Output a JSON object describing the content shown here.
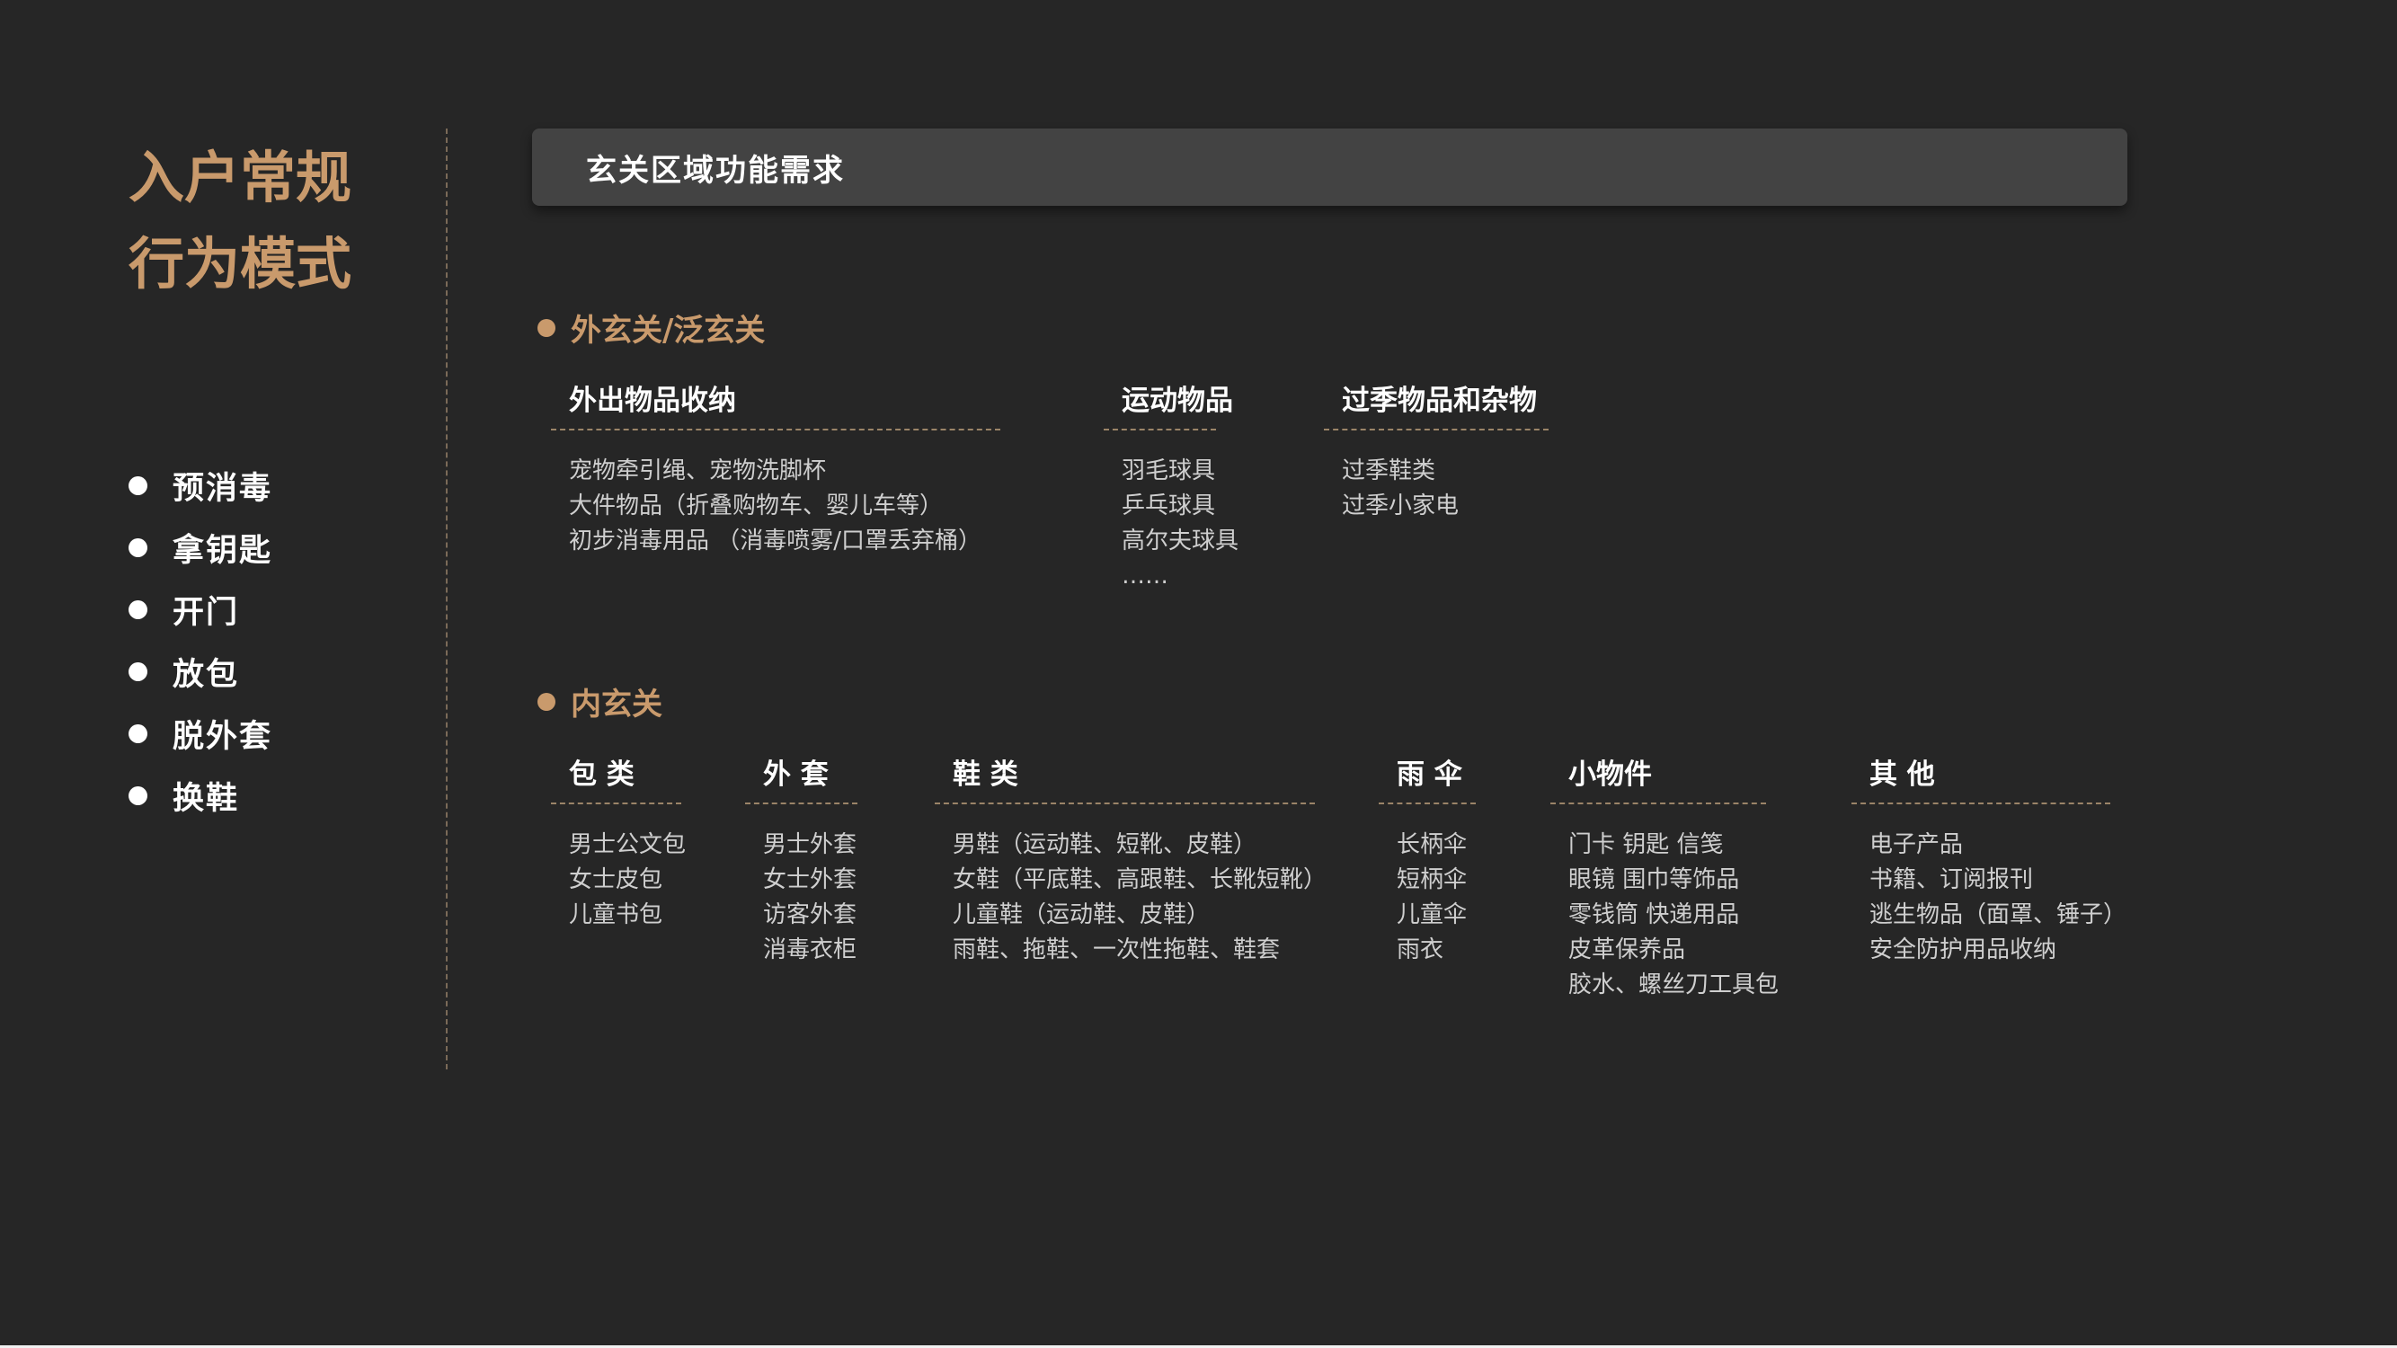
{
  "title": {
    "line1": "入户常规",
    "line2": "行为模式"
  },
  "behaviors": [
    "预消毒",
    "拿钥匙",
    "开门",
    "放包",
    "脱外套",
    "换鞋"
  ],
  "header": {
    "title": "玄关区域功能需求"
  },
  "outer": {
    "label": "外玄关/泛玄关",
    "columns": [
      {
        "heading": "外出物品收纳",
        "items": [
          "宠物牵引绳、宠物洗脚杯",
          "大件物品（折叠购物车、婴儿车等）",
          "初步消毒用品 （消毒喷雾/口罩丢弃桶）"
        ]
      },
      {
        "heading": "运动物品",
        "items": [
          "羽毛球具",
          "乒乓球具",
          "高尔夫球具",
          "……"
        ]
      },
      {
        "heading": "过季物品和杂物",
        "items": [
          "过季鞋类",
          "过季小家电"
        ]
      }
    ]
  },
  "inner": {
    "label": "内玄关",
    "columns": [
      {
        "heading": "包 类",
        "items": [
          "男士公文包",
          "女士皮包",
          "儿童书包"
        ]
      },
      {
        "heading": "外 套",
        "items": [
          "男士外套",
          "女士外套",
          "访客外套",
          "消毒衣柜"
        ]
      },
      {
        "heading": "鞋 类",
        "items": [
          "男鞋（运动鞋、短靴、皮鞋）",
          "女鞋（平底鞋、高跟鞋、长靴短靴）",
          "儿童鞋（运动鞋、皮鞋）",
          "雨鞋、拖鞋、一次性拖鞋、鞋套"
        ]
      },
      {
        "heading": "雨 伞",
        "items": [
          "长柄伞",
          "短柄伞",
          "儿童伞",
          "雨衣"
        ]
      },
      {
        "heading": "小物件",
        "items": [
          "门卡 钥匙 信笺",
          "眼镜 围巾等饰品",
          "零钱筒 快递用品",
          "皮革保养品",
          "胶水、螺丝刀工具包"
        ]
      },
      {
        "heading": "其 他",
        "items": [
          "电子产品",
          "书籍、订阅报刊",
          "逃生物品（面罩、锤子）",
          "安全防护用品收纳"
        ]
      }
    ]
  },
  "colors": {
    "accent": "#c99a6c",
    "background": "#262626",
    "bar": "#434343"
  }
}
